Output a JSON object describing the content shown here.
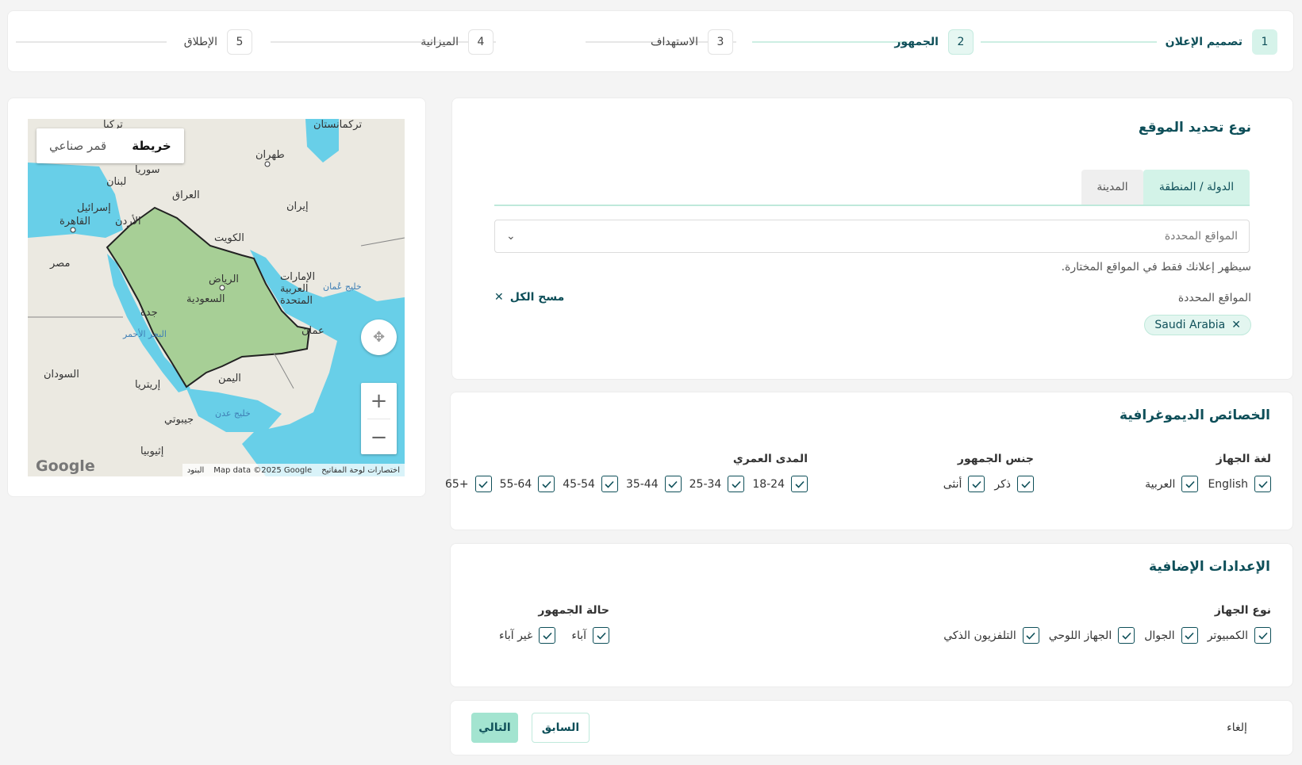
{
  "stepper": {
    "steps": [
      {
        "num": "1",
        "label": "تصميم الإعلان"
      },
      {
        "num": "2",
        "label": "الجمهور"
      },
      {
        "num": "3",
        "label": "الاستهداف"
      },
      {
        "num": "4",
        "label": "الميزانية"
      },
      {
        "num": "5",
        "label": "الإطلاق"
      }
    ]
  },
  "location": {
    "title": "نوع تحديد الموقع",
    "tabs": [
      "الدولة / المنطقة",
      "المدينة"
    ],
    "select_placeholder": "المواقع المحددة",
    "helper": "سيظهر إعلانك فقط في المواقع المختارة.",
    "selected_label": "المواقع المحددة",
    "clear_all": "مسح الكل",
    "chips": [
      "Saudi Arabia"
    ]
  },
  "demographics": {
    "title": "الخصائص الديموغرافية",
    "language": {
      "label": "لغة الجهاز",
      "options": [
        "English",
        "العربية"
      ]
    },
    "gender": {
      "label": "جنس الجمهور",
      "options": [
        "ذكر",
        "أنثى"
      ]
    },
    "age": {
      "label": "المدى العمري",
      "options": [
        "18-24",
        "25-34",
        "35-44",
        "45-54",
        "55-64",
        "65+"
      ]
    }
  },
  "extra": {
    "title": "الإعدادات الإضافية",
    "device": {
      "label": "نوع الجهاز",
      "options": [
        "الكمبيوتر",
        "الجوال",
        "الجهاز اللوحي",
        "التلفزيون الذكي"
      ]
    },
    "status": {
      "label": "حالة الجمهور",
      "options": [
        "آباء",
        "غير آباء"
      ]
    }
  },
  "footer": {
    "next": "التالي",
    "prev": "السابق",
    "cancel": "إلغاء"
  },
  "map": {
    "toggle": {
      "map": "خريطة",
      "satellite": "قمر صناعي"
    },
    "footer": {
      "shortcuts": "اختصارات لوحة المفاتيح",
      "data": "Map data ©2025 Google",
      "terms": "البنود"
    },
    "brand": "Google",
    "labels": {
      "turkmenistan": "تركمانستان",
      "turkey": "تركيا",
      "tehran": "طهران",
      "syria": "سوريا",
      "lebanon": "لبنان",
      "iraq": "العراق",
      "iran": "إيران",
      "israel": "إسرائيل",
      "jordan": "الأردن",
      "cairo": "القاهرة",
      "kuwait": "الكويت",
      "egypt": "مصر",
      "riyadh": "الرياض",
      "saudi": "السعودية",
      "uae1": "الإمارات",
      "uae2": "العربية",
      "uae3": "المتحدة",
      "oman_gulf": "خليج عُمان",
      "jeddah": "جدة",
      "red_sea": "البحر الأحمر",
      "oman": "عمان",
      "sudan": "السودان",
      "eritrea": "إريتريا",
      "yemen": "اليمن",
      "aden": "خليج عدن",
      "djibouti": "جيبوتي",
      "ethiopia": "إثيوبيا"
    },
    "colors": {
      "land": "#ebe9e1",
      "water": "#68cfe8",
      "selected": "#a7cf96",
      "border": "#222222"
    }
  }
}
